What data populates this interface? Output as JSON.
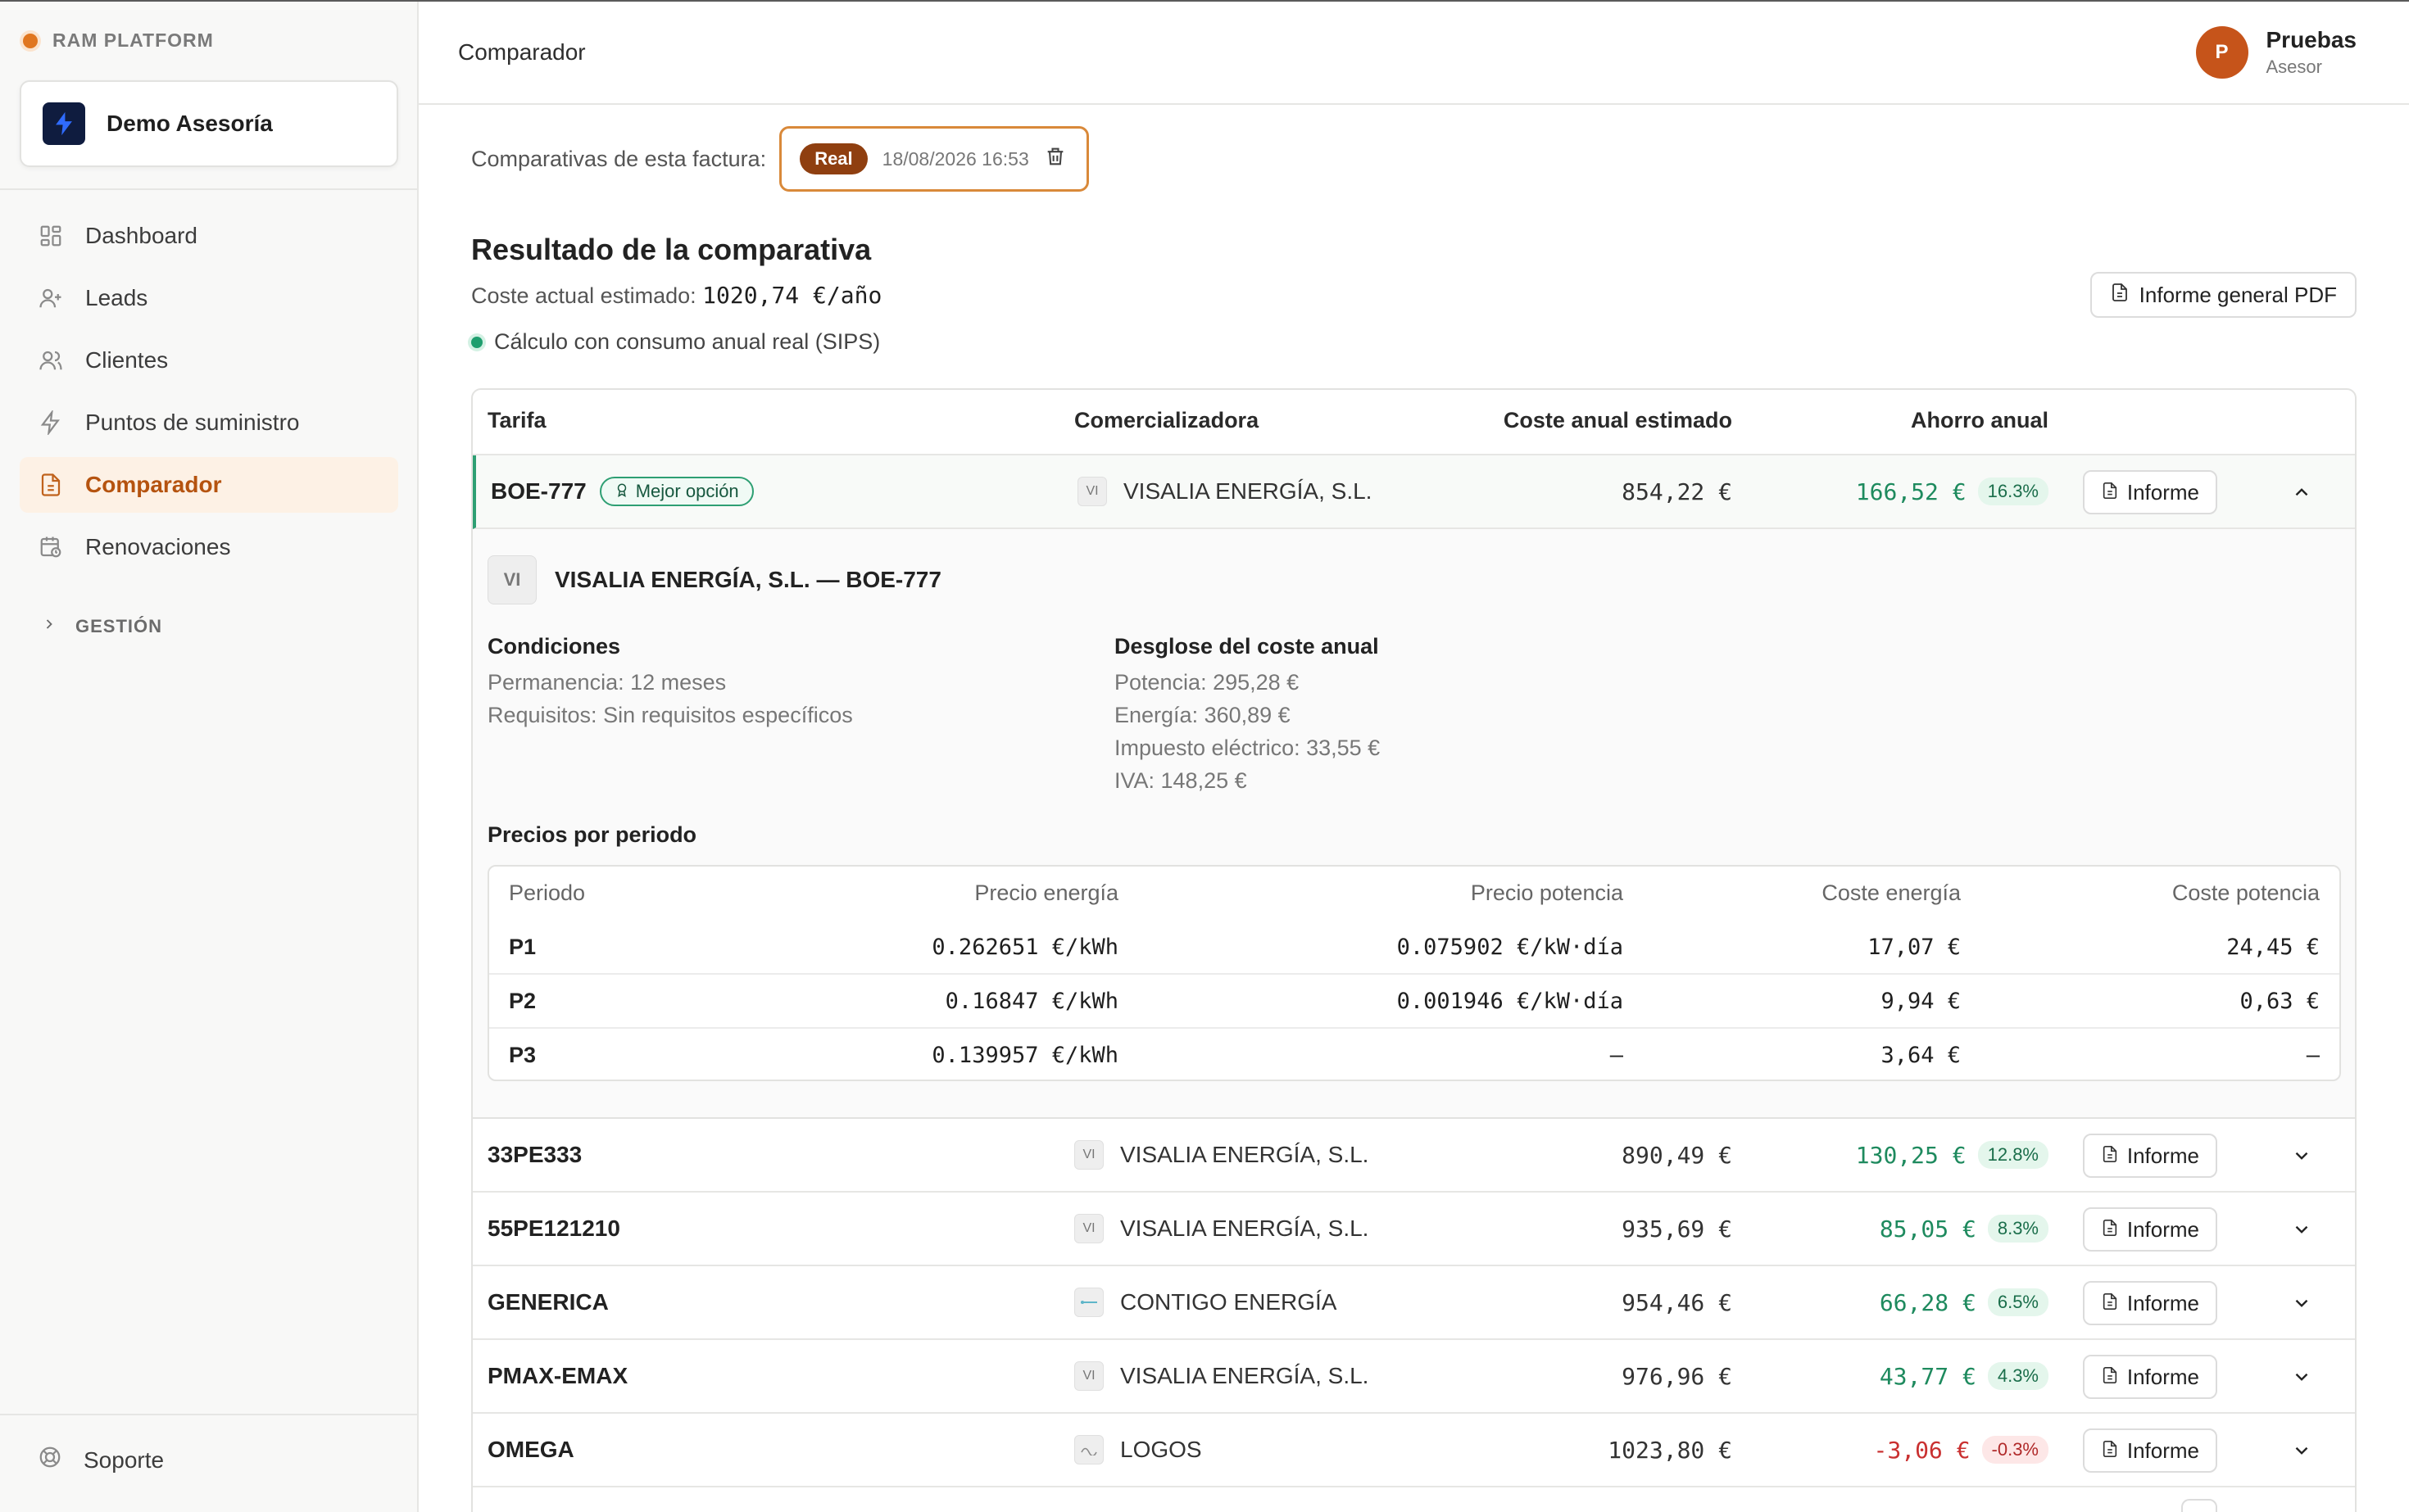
{
  "sidebar": {
    "brand": "RAM PLATFORM",
    "org_name": "Demo Asesoría",
    "items": [
      {
        "label": "Dashboard",
        "icon": "grid-icon"
      },
      {
        "label": "Leads",
        "icon": "user-plus-icon"
      },
      {
        "label": "Clientes",
        "icon": "users-icon"
      },
      {
        "label": "Puntos de suministro",
        "icon": "bolt-icon"
      },
      {
        "label": "Comparador",
        "icon": "document-icon",
        "active": true
      },
      {
        "label": "Renovaciones",
        "icon": "calendar-clock-icon"
      }
    ],
    "group_label": "GESTIÓN",
    "support_label": "Soporte"
  },
  "header": {
    "title": "Comparador",
    "user_initial": "P",
    "user_name": "Pruebas",
    "user_role": "Asesor"
  },
  "main": {
    "comparativas_label": "Comparativas de esta factura:",
    "comparativa_tag": "Real",
    "comparativa_date": "18/08/2026 16:53",
    "result_title": "Resultado de la comparativa",
    "cost_label": "Coste actual estimado:",
    "cost_value": "1020,74 €/año",
    "sips_label": "Cálculo con consumo anual real (SIPS)",
    "pdf_button": "Informe general PDF"
  },
  "table": {
    "headers": {
      "tarifa": "Tarifa",
      "comercializadora": "Comercializadora",
      "coste": "Coste anual estimado",
      "ahorro": "Ahorro anual"
    },
    "informe_label": "Informe",
    "best_badge": "Mejor opción",
    "best": {
      "tarifa": "BOE-777",
      "logo": "VI",
      "comercializadora": "VISALIA ENERGÍA, S.L.",
      "coste": "854,22 €",
      "ahorro": "166,52 €",
      "pct": "16.3%"
    },
    "rows": [
      {
        "tarifa": "33PE333",
        "logo": "VI",
        "comercializadora": "VISALIA ENERGÍA, S.L.",
        "coste": "890,49 €",
        "ahorro": "130,25 €",
        "pct": "12.8%"
      },
      {
        "tarifa": "55PE121210",
        "logo": "VI",
        "comercializadora": "VISALIA ENERGÍA, S.L.",
        "coste": "935,69 €",
        "ahorro": "85,05 €",
        "pct": "8.3%"
      },
      {
        "tarifa": "GENERICA",
        "logo": "",
        "comercializadora": "CONTIGO ENERGÍA",
        "coste": "954,46 €",
        "ahorro": "66,28 €",
        "pct": "6.5%"
      },
      {
        "tarifa": "PMAX-EMAX",
        "logo": "VI",
        "comercializadora": "VISALIA ENERGÍA, S.L.",
        "coste": "976,96 €",
        "ahorro": "43,77 €",
        "pct": "4.3%"
      },
      {
        "tarifa": "OMEGA",
        "logo": "",
        "comercializadora": "LOGOS",
        "coste": "1023,80 €",
        "ahorro": "-3,06 €",
        "pct": "-0.3%"
      }
    ]
  },
  "detail": {
    "logo": "VI",
    "title": "VISALIA ENERGÍA, S.L. — BOE-777",
    "condiciones_title": "Condiciones",
    "permanencia": "Permanencia: 12 meses",
    "requisitos": "Requisitos: Sin requisitos específicos",
    "desglose_title": "Desglose del coste anual",
    "potencia": "Potencia: 295,28 €",
    "energia": "Energía: 360,89 €",
    "impuesto": "Impuesto eléctrico: 33,55 €",
    "iva": "IVA: 148,25 €",
    "precios_title": "Precios por periodo",
    "price_headers": {
      "periodo": "Periodo",
      "precio_energia": "Precio energía",
      "precio_potencia": "Precio potencia",
      "coste_energia": "Coste energía",
      "coste_potencia": "Coste potencia"
    },
    "periods": [
      {
        "periodo": "P1",
        "precio_energia": "0.262651 €/kWh",
        "precio_potencia": "0.075902 €/kW·día",
        "coste_energia": "17,07 €",
        "coste_potencia": "24,45 €"
      },
      {
        "periodo": "P2",
        "precio_energia": "0.16847 €/kWh",
        "precio_potencia": "0.001946 €/kW·día",
        "coste_energia": "9,94 €",
        "coste_potencia": "0,63 €"
      },
      {
        "periodo": "P3",
        "precio_energia": "0.139957 €/kWh",
        "precio_potencia": "—",
        "coste_energia": "3,64 €",
        "coste_potencia": "—"
      }
    ]
  }
}
